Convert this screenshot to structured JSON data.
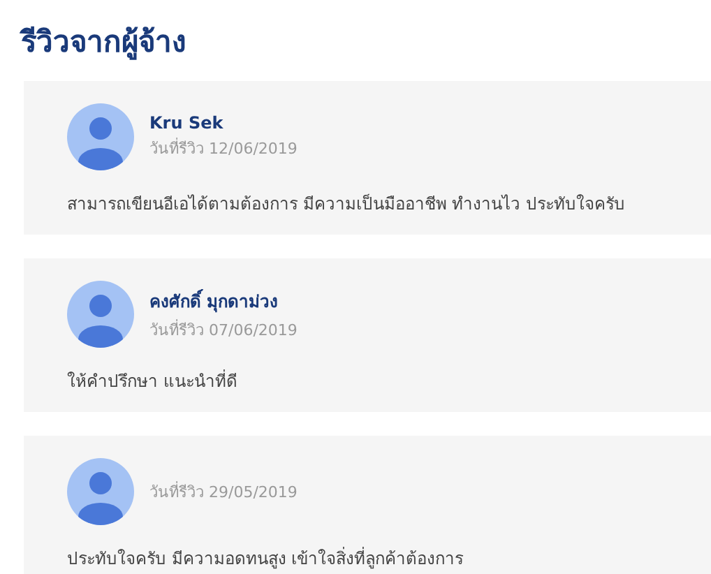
{
  "title": "รีวิวจากผู้จ้าง",
  "reviews": [
    {
      "name": "Kru Sek",
      "date": "วันที่รีวิว 12/06/2019",
      "comment": "สามารถเขียนอีเอได้ตามต้องการ มีความเป็นมืออาชีพ ทำงานไว ประทับใจครับ"
    },
    {
      "name": "คงศักดิ์ มุกดาม่วง",
      "date": "วันที่รีวิว 07/06/2019",
      "comment": "ให้คำปรึกษา แนะนำที่ดี"
    },
    {
      "date": "วันที่รีวิว 29/05/2019",
      "comment": "ประทับใจครับ มีความอดทนสูง เข้าใจสิ่งที่ลูกค้าต้องการ"
    }
  ]
}
